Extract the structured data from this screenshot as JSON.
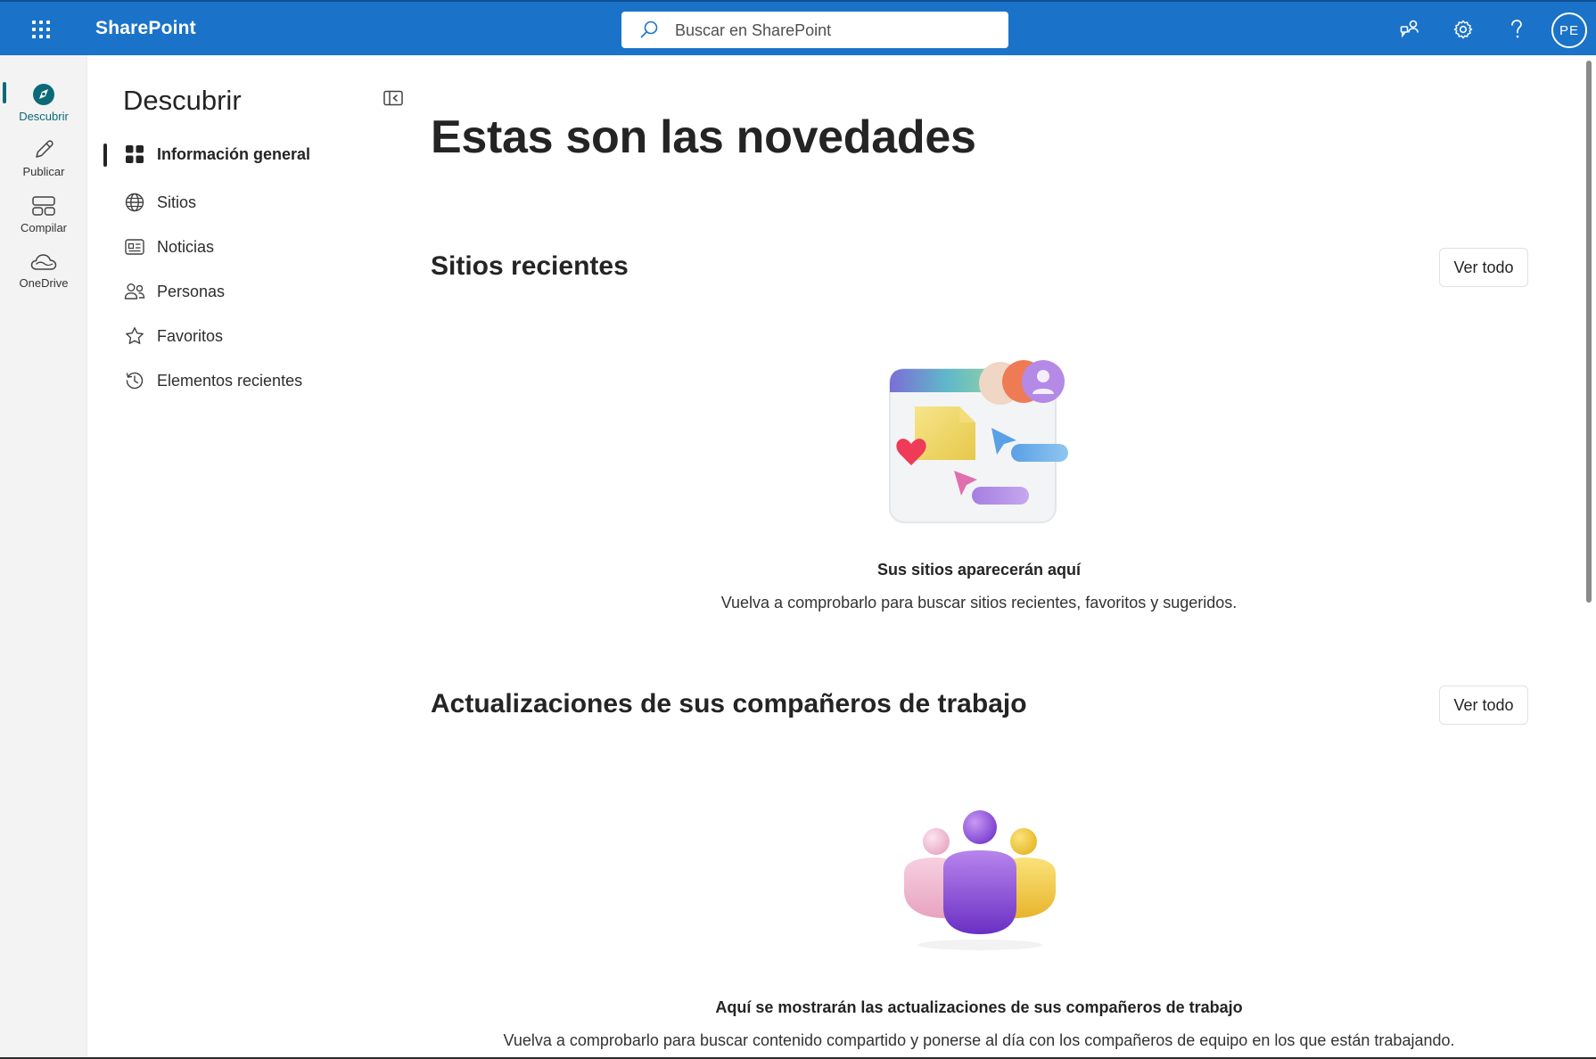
{
  "app": {
    "brand": "SharePoint",
    "search_placeholder": "Buscar en SharePoint",
    "avatar_initials": "PE"
  },
  "rail": {
    "items": [
      {
        "label": "Descubrir",
        "icon": "discover-icon",
        "active": true
      },
      {
        "label": "Publicar",
        "icon": "pencil-icon",
        "active": false
      },
      {
        "label": "Compilar",
        "icon": "build-layout-icon",
        "active": false
      },
      {
        "label": "OneDrive",
        "icon": "onedrive-cloud-icon",
        "active": false
      }
    ]
  },
  "subnav": {
    "title": "Descubrir",
    "items": [
      {
        "label": "Información general",
        "icon": "grid-icon",
        "active": true
      },
      {
        "label": "Sitios",
        "icon": "globe-icon",
        "active": false
      },
      {
        "label": "Noticias",
        "icon": "news-icon",
        "active": false
      },
      {
        "label": "Personas",
        "icon": "people-icon",
        "active": false
      },
      {
        "label": "Favoritos",
        "icon": "star-icon",
        "active": false
      },
      {
        "label": "Elementos recientes",
        "icon": "history-icon",
        "active": false
      }
    ]
  },
  "main": {
    "title": "Estas son las novedades",
    "sections": [
      {
        "title": "Sitios recientes",
        "see_all": "Ver todo",
        "empty_title": "Sus sitios aparecerán aquí",
        "empty_desc": "Vuelva a comprobarlo para buscar sitios recientes, favoritos y sugeridos."
      },
      {
        "title": "Actualizaciones de sus compañeros de trabajo",
        "see_all": "Ver todo",
        "empty_title": "Aquí se mostrarán las actualizaciones de sus compañeros de trabajo",
        "empty_desc": "Vuelva a comprobarlo para buscar contenido compartido y ponerse al día con los compañeros de equipo en los que están trabajando."
      }
    ]
  },
  "colors": {
    "suite_bar": "#1a73c8",
    "accent_teal": "#0b6a78",
    "rail_bg": "#f3f3f3"
  }
}
